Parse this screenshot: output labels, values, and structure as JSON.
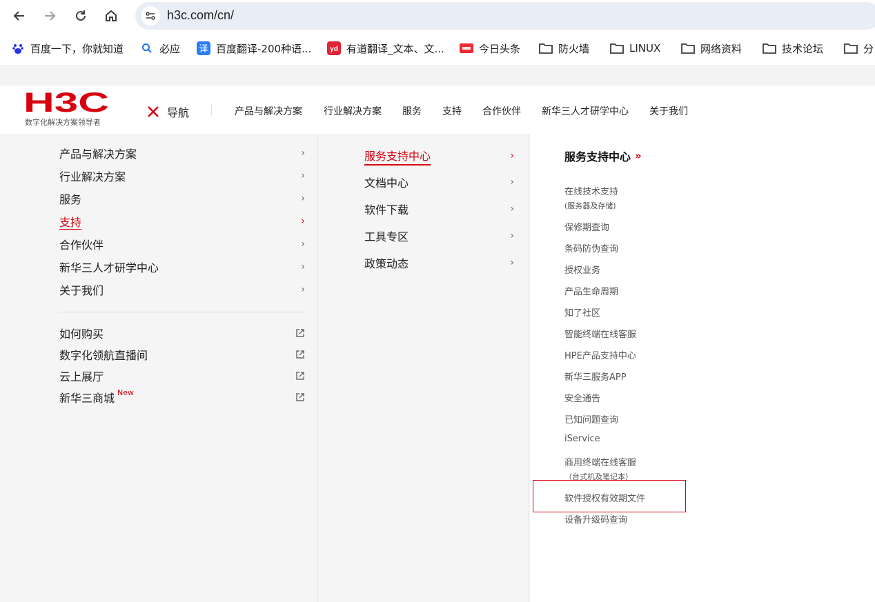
{
  "browser": {
    "url": "h3c.com/cn/"
  },
  "bookmarks": [
    {
      "icon": "baidu-paw-icon",
      "label": "百度一下，你就知道"
    },
    {
      "icon": "search-icon",
      "label": "必应"
    },
    {
      "icon": "baidu-translate-icon",
      "label": "百度翻译-200种语..."
    },
    {
      "icon": "youdao-icon",
      "label": "有道翻译_文本、文..."
    },
    {
      "icon": "toutiao-icon",
      "label": "今日头条"
    },
    {
      "icon": "folder-icon",
      "label": "防火墙"
    },
    {
      "icon": "folder-icon",
      "label": "LINUX"
    },
    {
      "icon": "folder-icon",
      "label": "网络资料"
    },
    {
      "icon": "folder-icon",
      "label": "技术论坛"
    },
    {
      "icon": "folder-icon",
      "label": "分"
    }
  ],
  "header": {
    "logo_text": "H3C",
    "logo_subtitle": "数字化解决方案领导者",
    "close_label": "导航",
    "nav_items": [
      "产品与解决方案",
      "行业解决方案",
      "服务",
      "支持",
      "合作伙伴",
      "新华三人才研学中心",
      "关于我们"
    ]
  },
  "menu_level1": {
    "items": [
      {
        "label": "产品与解决方案",
        "active": false
      },
      {
        "label": "行业解决方案",
        "active": false
      },
      {
        "label": "服务",
        "active": false
      },
      {
        "label": "支持",
        "active": true
      },
      {
        "label": "合作伙伴",
        "active": false
      },
      {
        "label": "新华三人才研学中心",
        "active": false
      },
      {
        "label": "关于我们",
        "active": false
      }
    ],
    "external_links": [
      {
        "label": "如何购买",
        "badge": ""
      },
      {
        "label": "数字化领航直播间",
        "badge": ""
      },
      {
        "label": "云上展厅",
        "badge": ""
      },
      {
        "label": "新华三商城",
        "badge": "New"
      }
    ]
  },
  "menu_level2": {
    "items": [
      {
        "label": "服务支持中心",
        "active": true
      },
      {
        "label": "文档中心",
        "active": false
      },
      {
        "label": "软件下载",
        "active": false
      },
      {
        "label": "工具专区",
        "active": false
      },
      {
        "label": "政策动态",
        "active": false
      }
    ]
  },
  "menu_level3": {
    "title": "服务支持中心",
    "title_arrow": "»",
    "items": [
      {
        "label": "在线技术支持",
        "sub": "(服务器及存储)"
      },
      {
        "label": "保修期查询",
        "sub": ""
      },
      {
        "label": "条码防伪查询",
        "sub": ""
      },
      {
        "label": "授权业务",
        "sub": ""
      },
      {
        "label": "产品生命周期",
        "sub": ""
      },
      {
        "label": "知了社区",
        "sub": ""
      },
      {
        "label": "智能终端在线客服",
        "sub": ""
      },
      {
        "label": "HPE产品支持中心",
        "sub": ""
      },
      {
        "label": "新华三服务APP",
        "sub": ""
      },
      {
        "label": "安全通告",
        "sub": ""
      },
      {
        "label": "已知问题查询",
        "sub": ""
      },
      {
        "label": "iService",
        "sub": ""
      },
      {
        "label": "商用终端在线客服",
        "sub": "（台式机及笔记本）"
      },
      {
        "label": "软件授权有效期文件",
        "sub": ""
      },
      {
        "label": "设备升级码查询",
        "sub": ""
      }
    ]
  },
  "colors": {
    "brand_red": "#d7000f",
    "text": "#222222",
    "highlight_box": "#d7000f"
  }
}
